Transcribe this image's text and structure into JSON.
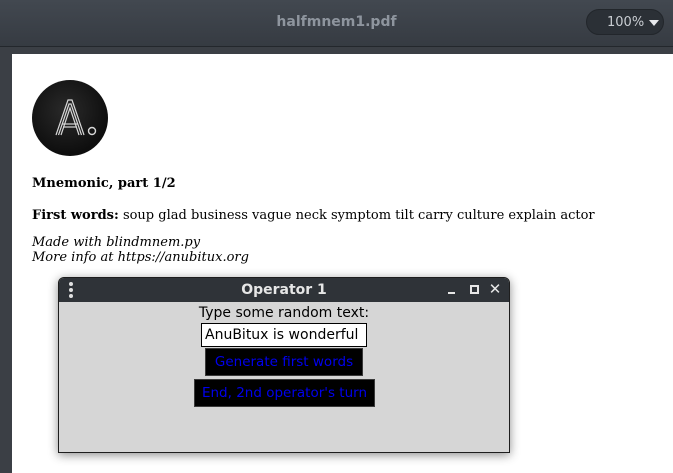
{
  "viewer": {
    "title": "halfmnem1.pdf",
    "zoom": "100%"
  },
  "document": {
    "heading": "Mnemonic, part 1/2",
    "first_words_label": "First words:",
    "first_words": "soup glad business vague neck symptom tilt carry culture explain actor",
    "made_with": "Made with blindmnem.py",
    "more_info": "More info at https://anubitux.org"
  },
  "operator_window": {
    "title": "Operator 1",
    "prompt": "Type some random text:",
    "input_value": "AnuBitux is wonderful",
    "generate_label": "Generate first words",
    "end_label": "End, 2nd operator's turn"
  }
}
